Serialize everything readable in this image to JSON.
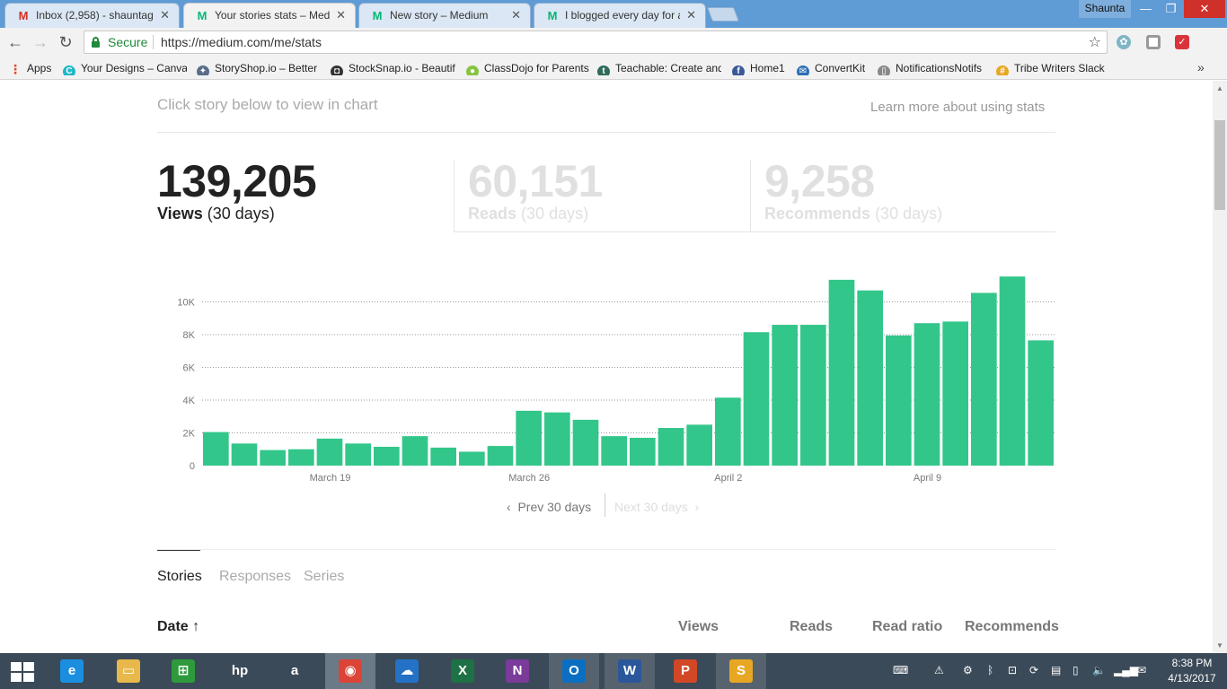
{
  "browser": {
    "tabs": [
      {
        "title": "Inbox (2,958) - shauntag",
        "icon": "gmail-icon",
        "color": "#d93025",
        "glyph": "M",
        "active": false
      },
      {
        "title": "Your stories stats – Medi",
        "icon": "medium-icon",
        "color": "#02b875",
        "glyph": "M",
        "active": true
      },
      {
        "title": "New story – Medium",
        "icon": "medium-icon",
        "color": "#02b875",
        "glyph": "M",
        "active": false
      },
      {
        "title": "I blogged every day for a",
        "icon": "medium-icon",
        "color": "#02b875",
        "glyph": "M",
        "active": false
      }
    ],
    "profile_name": "Shaunta",
    "secure_label": "Secure",
    "url": "https://medium.com/me/stats",
    "bookmarks": [
      {
        "label": "Apps",
        "icon": "apps-grid-icon"
      },
      {
        "label": "Your Designs – Canva",
        "icon": "canva-icon"
      },
      {
        "label": "StoryShop.io – Better",
        "icon": "storyshop-icon"
      },
      {
        "label": "StockSnap.io - Beautif",
        "icon": "camera-icon"
      },
      {
        "label": "ClassDojo for Parents",
        "icon": "classdojo-icon"
      },
      {
        "label": "Teachable: Create and",
        "icon": "teachable-icon"
      },
      {
        "label": "Home1",
        "icon": "facebook-icon"
      },
      {
        "label": "ConvertKit",
        "icon": "mail-icon"
      },
      {
        "label": "NotificationsNotifs",
        "icon": "page-icon"
      },
      {
        "label": "Tribe Writers Slack",
        "icon": "slack-icon"
      }
    ]
  },
  "stats_page": {
    "hint": "Click story below to view in chart",
    "learn_more": "Learn more about using stats",
    "metrics": [
      {
        "value": "139,205",
        "label": "Views",
        "period": "(30 days)",
        "active": true
      },
      {
        "value": "60,151",
        "label": "Reads",
        "period": "(30 days)",
        "active": false
      },
      {
        "value": "9,258",
        "label": "Recommends",
        "period": "(30 days)",
        "active": false
      }
    ],
    "pager": {
      "prev": "Prev 30 days",
      "next": "Next 30 days"
    },
    "tabs": [
      "Stories",
      "Responses",
      "Series"
    ],
    "table_headers": {
      "date": "Date",
      "views": "Views",
      "reads": "Reads",
      "read_ratio": "Read ratio",
      "recommends": "Recommends"
    }
  },
  "chart_data": {
    "type": "bar",
    "categories": [
      "Mar 15",
      "Mar 16",
      "Mar 17",
      "Mar 18",
      "Mar 19",
      "Mar 20",
      "Mar 21",
      "Mar 22",
      "Mar 23",
      "Mar 24",
      "Mar 25",
      "Mar 26",
      "Mar 27",
      "Mar 28",
      "Mar 29",
      "Mar 30",
      "Mar 31",
      "Apr 1",
      "Apr 2",
      "Apr 3",
      "Apr 4",
      "Apr 5",
      "Apr 6",
      "Apr 7",
      "Apr 8",
      "Apr 9",
      "Apr 10",
      "Apr 11",
      "Apr 12",
      "Apr 13"
    ],
    "values": [
      2050,
      1350,
      950,
      1000,
      1650,
      1350,
      1150,
      1800,
      1100,
      850,
      1200,
      3350,
      3250,
      2800,
      1800,
      1700,
      2300,
      2500,
      4150,
      8150,
      8600,
      8600,
      11350,
      10700,
      7950,
      8700,
      8800,
      10550,
      11550,
      7650
    ],
    "ylim": [
      0,
      12000
    ],
    "yticks": [
      0,
      2000,
      4000,
      6000,
      8000,
      10000
    ],
    "ytick_labels": [
      "0",
      "2K",
      "4K",
      "6K",
      "8K",
      "10K"
    ],
    "xtick_labels": [
      {
        "label": "March 19",
        "index": 4.5
      },
      {
        "label": "March 26",
        "index": 11.5
      },
      {
        "label": "April 2",
        "index": 18.5
      },
      {
        "label": "April 9",
        "index": 25.5
      }
    ],
    "bar_color": "#33c68a",
    "grid": "dotted horizontal"
  },
  "taskbar": {
    "apps": [
      {
        "name": "internet-explorer-icon",
        "glyph": "e",
        "color": "#1b8ee0"
      },
      {
        "name": "file-explorer-icon",
        "glyph": "▭",
        "color": "#e8b84a"
      },
      {
        "name": "store-icon",
        "glyph": "⊞",
        "color": "#2e9a3c"
      },
      {
        "name": "hp-icon",
        "glyph": "hp",
        "color": "#3b4a58"
      },
      {
        "name": "amazon-icon",
        "glyph": "a",
        "color": "#3b4a58"
      },
      {
        "name": "chrome-icon",
        "glyph": "◉",
        "color": "#db4437"
      },
      {
        "name": "onedrive-icon",
        "glyph": "☁",
        "color": "#2372c6"
      },
      {
        "name": "excel-icon",
        "glyph": "X",
        "color": "#1e7145"
      },
      {
        "name": "onenote-icon",
        "glyph": "N",
        "color": "#7a3b9a"
      },
      {
        "name": "outlook-icon",
        "glyph": "O",
        "color": "#0a6fc2"
      },
      {
        "name": "word-icon",
        "glyph": "W",
        "color": "#2b579a"
      },
      {
        "name": "powerpoint-icon",
        "glyph": "P",
        "color": "#d24726"
      },
      {
        "name": "slack-icon",
        "glyph": "S",
        "color": "#e8a723"
      }
    ],
    "time": "8:38 PM",
    "date": "4/13/2017"
  }
}
